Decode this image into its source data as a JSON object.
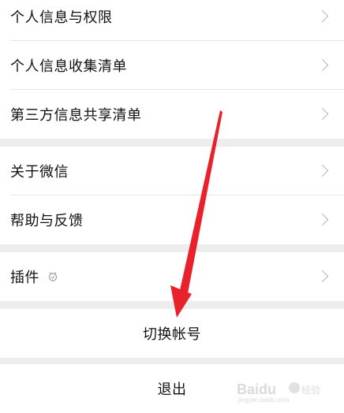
{
  "group1": {
    "items": [
      {
        "label": "个人信息与权限"
      },
      {
        "label": "个人信息收集清单"
      },
      {
        "label": "第三方信息共享清单"
      }
    ]
  },
  "group2": {
    "items": [
      {
        "label": "关于微信"
      },
      {
        "label": "帮助与反馈"
      }
    ]
  },
  "group3": {
    "items": [
      {
        "label": "插件",
        "icon": "plugin-icon"
      }
    ]
  },
  "switch_account": {
    "label": "切换帐号"
  },
  "logout": {
    "label": "退出"
  },
  "watermark": {
    "brand": "Baidu",
    "subtitle": "jingyan.baidu.com"
  },
  "colors": {
    "background": "#ededed",
    "card": "#ffffff",
    "text": "#111111",
    "arrow": "#e8212a",
    "chevron": "#b3b3b3"
  }
}
